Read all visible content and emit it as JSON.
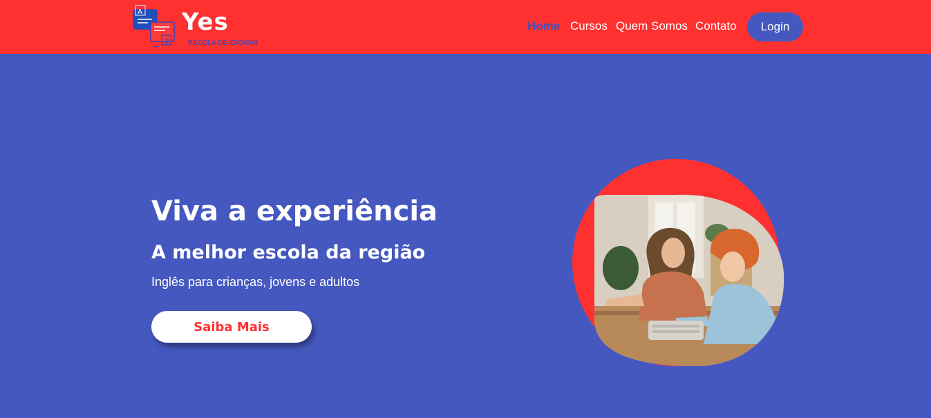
{
  "brand": {
    "name": "Yes",
    "tagline": "ESCOLA DE IDIOMAS",
    "icon": "translation-cards-icon"
  },
  "nav": {
    "items": [
      {
        "label": "Home",
        "active": true
      },
      {
        "label": "Cursos",
        "active": false
      },
      {
        "label": "Quem Somos",
        "active": false
      },
      {
        "label": "Contato",
        "active": false
      }
    ],
    "login_label": "Login"
  },
  "hero": {
    "title": "Viva a experiência",
    "subtitle": "A melhor escola da região",
    "description": "Inglês para crianças, jovens e adultos",
    "cta_label": "Saiba Mais",
    "image_subject": "teacher-and-student-at-computer-photo"
  },
  "colors": {
    "header_bg": "#ff3030",
    "hero_bg": "#4558bf",
    "accent_red": "#ff3030",
    "accent_blue": "#4558bf",
    "text_white": "#ffffff"
  }
}
